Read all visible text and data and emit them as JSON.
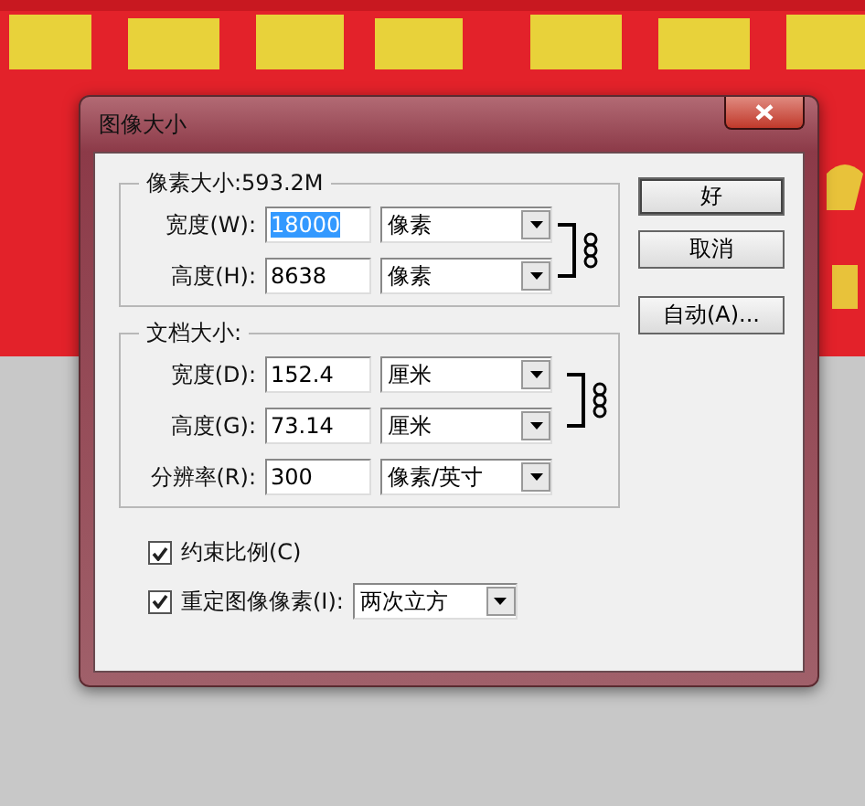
{
  "dialog": {
    "title": "图像大小",
    "pixel_dimensions": {
      "legend": "像素大小:593.2M",
      "linked": true,
      "fields": [
        {
          "label": "宽度(W):",
          "value": "18000",
          "selected": true,
          "unit": "像素"
        },
        {
          "label": "高度(H):",
          "value": "8638",
          "selected": false,
          "unit": "像素"
        }
      ]
    },
    "document_size": {
      "legend": "文档大小:",
      "linked": true,
      "fields": [
        {
          "label": "宽度(D):",
          "value": "152.4",
          "selected": false,
          "unit": "厘米"
        },
        {
          "label": "高度(G):",
          "value": "73.14",
          "selected": false,
          "unit": "厘米"
        }
      ],
      "resolution": {
        "label": "分辨率(R):",
        "value": "300",
        "selected": false,
        "unit": "像素/英寸"
      }
    },
    "options": [
      {
        "label": "约束比例(C)",
        "checked": true
      },
      {
        "label": "重定图像像素(I):",
        "checked": true,
        "dropdown": "两次立方"
      }
    ],
    "buttons": [
      "好",
      "取消",
      "自动(A)..."
    ]
  }
}
